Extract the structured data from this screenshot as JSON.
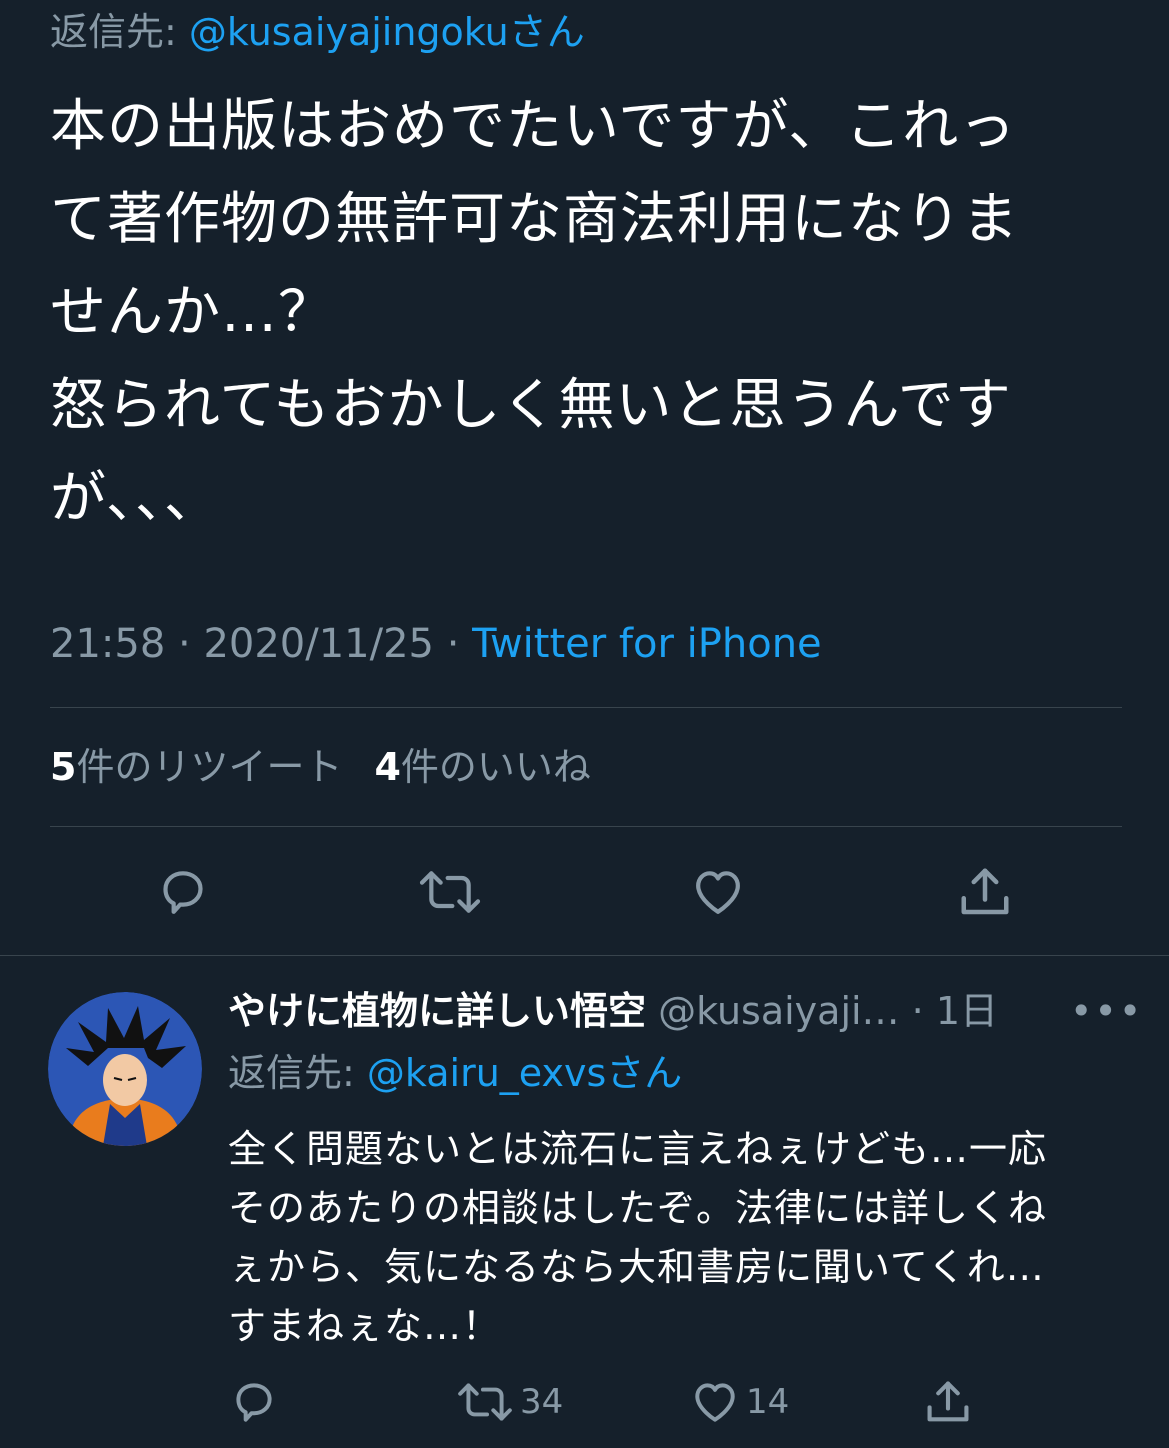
{
  "tweet": {
    "reply_to_prefix": "返信先: ",
    "reply_to_handle": "@kusaiyajingoku",
    "reply_to_suffix": "さん",
    "lines": [
      "本の出版はおめでたいですが、これっ",
      "て著作物の無許可な商法利用になりま",
      "せんか…？",
      "怒られてもおかしく無いと思うんです",
      "が、、、"
    ],
    "time": "21:58",
    "date": "2020/11/25",
    "separator": " · ",
    "source": "Twitter for iPhone",
    "retweet_count": "5",
    "retweet_label": "件のリツイート",
    "like_count": "4",
    "like_label": "件のいいね"
  },
  "reply": {
    "display_name": "やけに植物に詳しい悟空",
    "handle": "@kusaiyaji…",
    "time_ago": "1日",
    "time_sep": " · ",
    "more": "•••",
    "reply_to_prefix": "返信先: ",
    "reply_to_handle": "@kairu_exvs",
    "reply_to_suffix": "さん",
    "lines": [
      "全く問題ないとは流石に言えねぇけども…一応",
      "そのあたりの相談はしたぞ。法律には詳しくね",
      "ぇから、気になるなら大和書房に聞いてくれ…",
      "すまねぇな…！"
    ],
    "retweets": "34",
    "likes": "14"
  },
  "icons": {
    "reply": "reply-icon",
    "retweet": "retweet-icon",
    "like": "heart-icon",
    "share": "share-icon"
  },
  "colors": {
    "background": "#15202b",
    "muted": "#8899a6",
    "link": "#1da1f2",
    "divider": "#38444d"
  }
}
